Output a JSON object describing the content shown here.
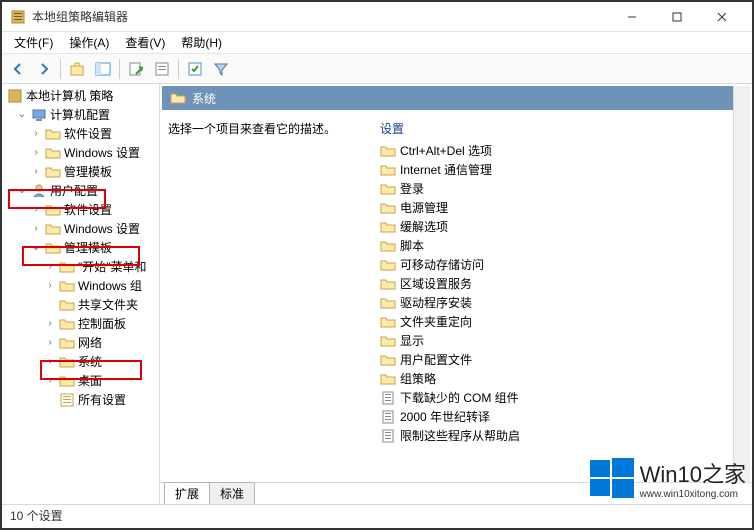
{
  "window": {
    "title": "本地组策略编辑器"
  },
  "menu": {
    "file": "文件(F)",
    "action": "操作(A)",
    "view": "查看(V)",
    "help": "帮助(H)"
  },
  "tree": {
    "root": "本地计算机 策略",
    "comp_cfg": "计算机配置",
    "comp_soft": "软件设置",
    "comp_win": "Windows 设置",
    "comp_tmpl": "管理模板",
    "user_cfg": "用户配置",
    "user_soft": "软件设置",
    "user_win": "Windows 设置",
    "user_tmpl": "管理模板",
    "start_menu": "\"开始\"菜单和",
    "win_comp": "Windows 组",
    "shared": "共享文件夹",
    "cpanel": "控制面板",
    "network": "网络",
    "system": "系统",
    "desktop": "桌面",
    "all": "所有设置"
  },
  "header": {
    "title": "系统"
  },
  "desc": "选择一个项目来查看它的描述。",
  "list_head": "设置",
  "items": {
    "i0": "Ctrl+Alt+Del 选项",
    "i1": "Internet 通信管理",
    "i2": "登录",
    "i3": "电源管理",
    "i4": "缓解选项",
    "i5": "脚本",
    "i6": "可移动存储访问",
    "i7": "区域设置服务",
    "i8": "驱动程序安装",
    "i9": "文件夹重定向",
    "i10": "显示",
    "i11": "用户配置文件",
    "i12": "组策略",
    "i13": "下载缺少的 COM 组件",
    "i14": "2000 年世纪转译",
    "i15": "限制这些程序从帮助启"
  },
  "tabs": {
    "ext": "扩展",
    "std": "标准"
  },
  "status": "10 个设置",
  "watermark": {
    "brand": "Win10",
    "suffix": "之家",
    "url": "www.win10xitong.com"
  }
}
